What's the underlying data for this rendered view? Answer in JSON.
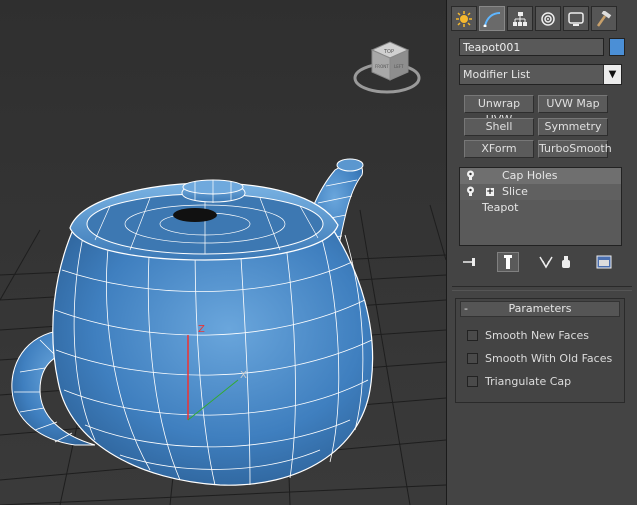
{
  "command_panel": {
    "tabs": [
      {
        "name": "create-tab",
        "icon": "sun-icon"
      },
      {
        "name": "modify-tab",
        "icon": "modify-curve-icon"
      },
      {
        "name": "hierarchy-tab",
        "icon": "hierarchy-icon"
      },
      {
        "name": "motion-tab",
        "icon": "motion-icon"
      },
      {
        "name": "display-tab",
        "icon": "monitor-icon"
      },
      {
        "name": "utilities-tab",
        "icon": "hammer-icon"
      }
    ],
    "active_tab": "modify-tab",
    "object_name": "Teapot001",
    "object_color": "#4b8fd6",
    "modifier_list_label": "Modifier List",
    "quick_buttons": [
      [
        "Unwrap UVW",
        "UVW Map"
      ],
      [
        "Shell",
        "Symmetry"
      ],
      [
        "XForm",
        "TurboSmooth"
      ]
    ],
    "modifier_stack": [
      {
        "label": "Cap Holes",
        "has_bulb": true,
        "expandable": false
      },
      {
        "label": "Slice",
        "has_bulb": true,
        "expandable": true
      },
      {
        "label": "Teapot",
        "has_bulb": false,
        "expandable": false
      }
    ],
    "stack_tools": [
      "pin-stack-icon",
      "show-end-result-icon",
      "make-unique-icon",
      "remove-modifier-icon",
      "configure-modifier-sets-icon"
    ],
    "parameters": {
      "title": "Parameters",
      "collapse_symbol": "-",
      "options": [
        "Smooth New Faces",
        "Smooth With Old Faces",
        "Triangulate Cap"
      ]
    }
  },
  "viewport": {
    "viewcube_faces": [
      "TOP",
      "FRONT",
      "LEFT"
    ],
    "gizmo_axis_labels": [
      "Z",
      "X"
    ],
    "mesh_color": "#4a88c7",
    "wire_color": "#ffffff"
  }
}
